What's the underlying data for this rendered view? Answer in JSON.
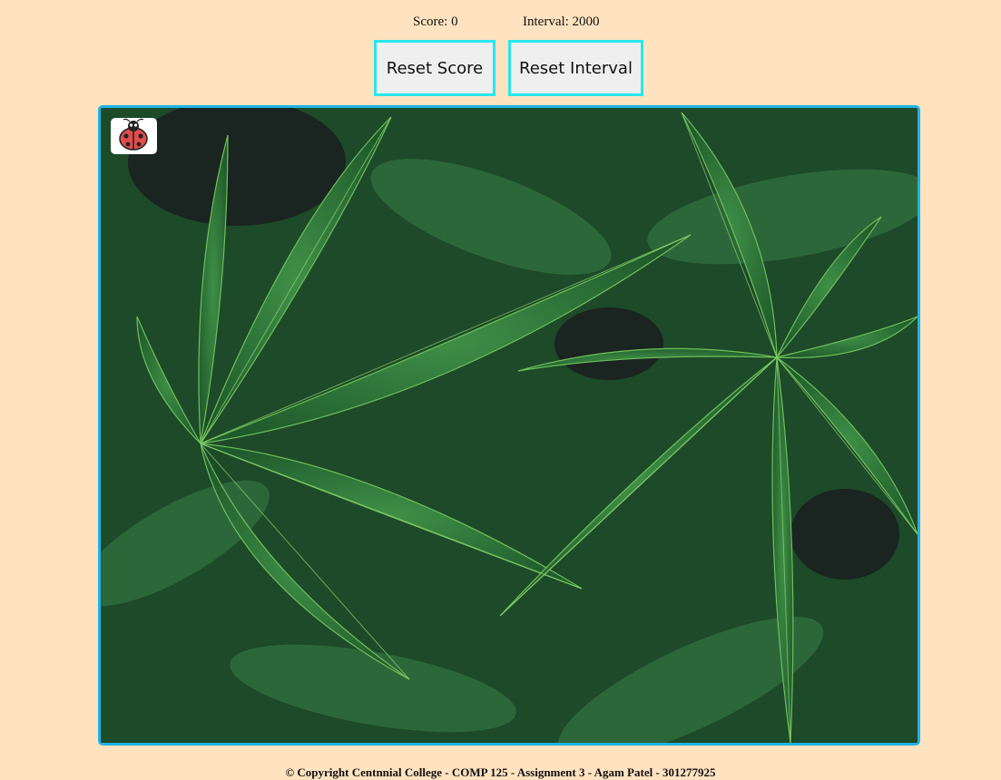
{
  "stats": {
    "score_text": "Score: 0",
    "interval_text": "Interval: 2000"
  },
  "buttons": {
    "reset_score": "Reset Score",
    "reset_interval": "Reset Interval"
  },
  "board": {
    "background": "cannabis-leaves-photo",
    "border_color": "#1fb3e6",
    "target_icon": "ladybug-icon"
  },
  "footer": {
    "copyright": "©  Copyright Centnnial College - COMP 125 - Assignment 3 - Agam Patel - 301277925"
  },
  "colors": {
    "page_background": "#ffe3c0",
    "button_border": "#27e6ee"
  }
}
